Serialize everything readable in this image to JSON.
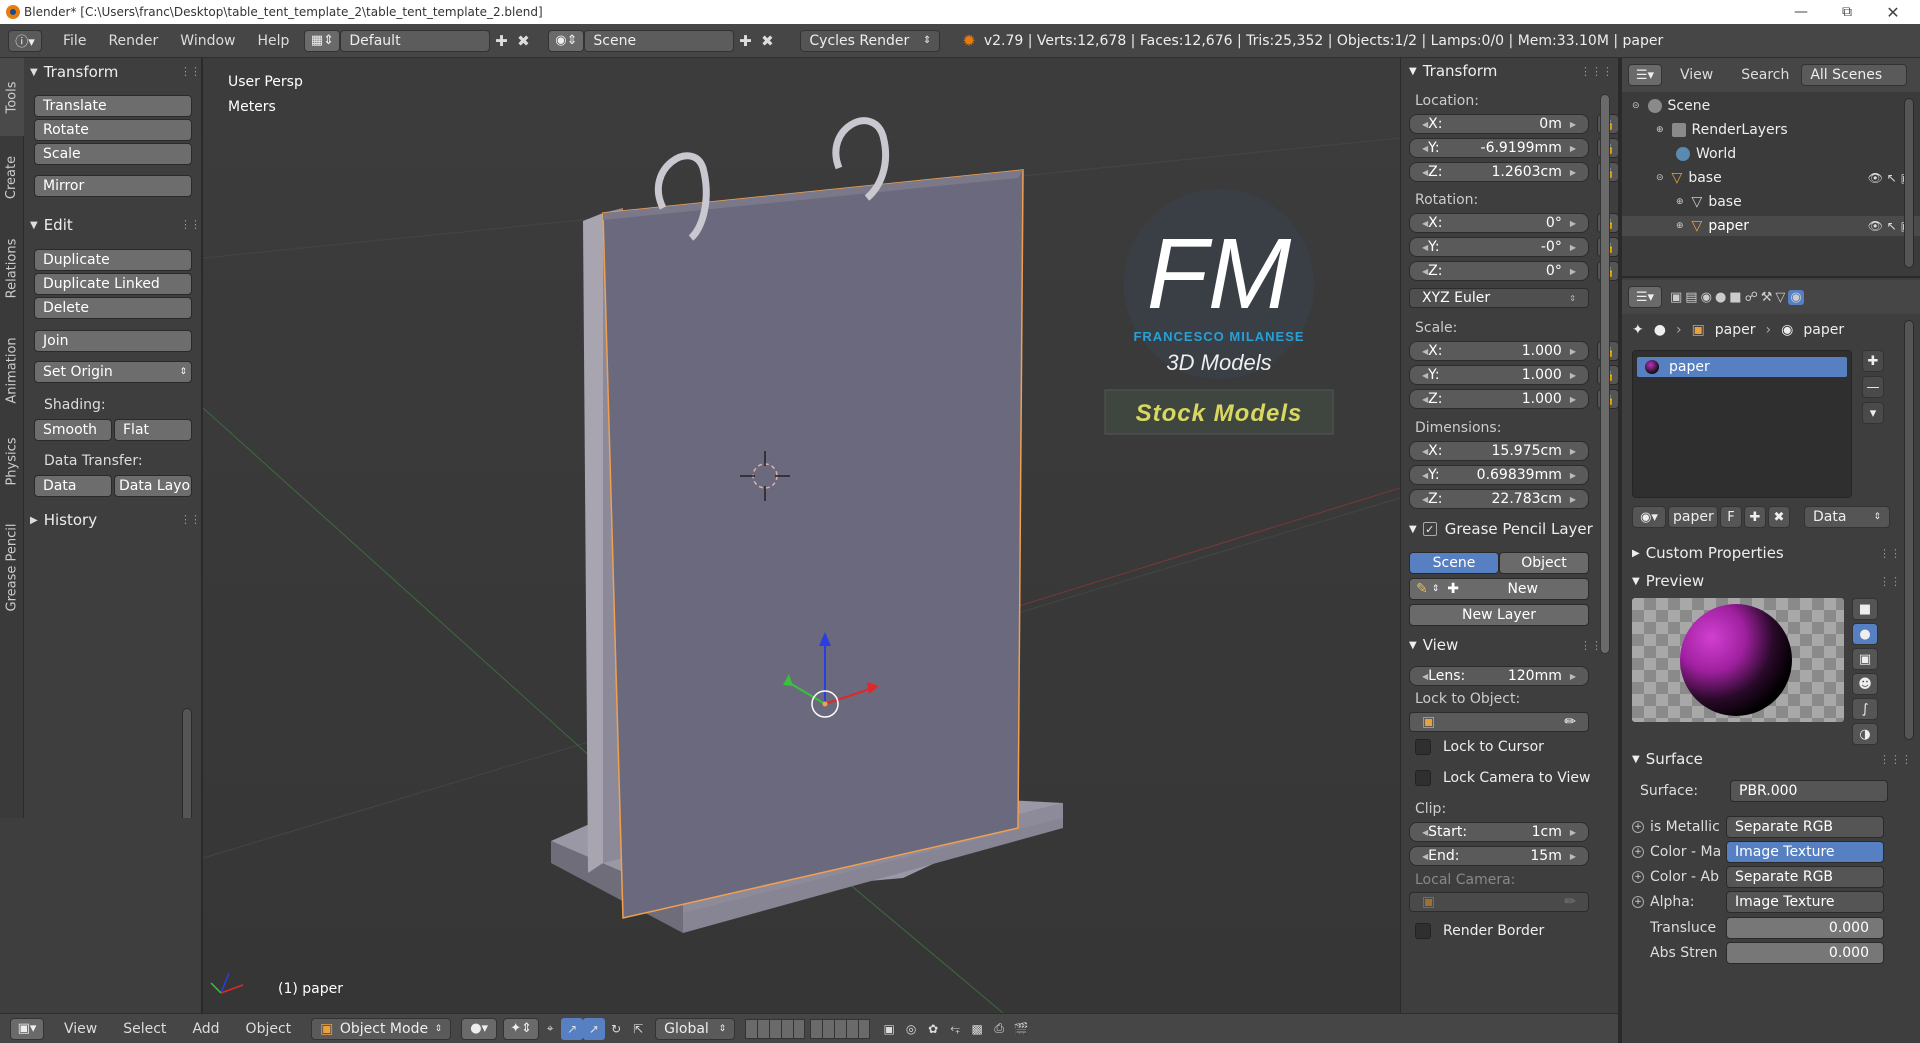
{
  "window": {
    "title": "Blender* [C:\\Users\\franc\\Desktop\\table_tent_template_2\\table_tent_template_2.blend]"
  },
  "topbar": {
    "menus": [
      "File",
      "Render",
      "Window",
      "Help"
    ],
    "layout": "Default",
    "scene": "Scene",
    "engine": "Cycles Render",
    "stats": "v2.79 | Verts:12,678 | Faces:12,676 | Tris:25,352 | Objects:1/2 | Lamps:0/0 | Mem:33.10M | paper"
  },
  "tool_tabs": [
    "Tools",
    "Create",
    "Relations",
    "Animation",
    "Physics",
    "Grease Pencil"
  ],
  "toolbar": {
    "transform_title": "Transform",
    "transform_buttons": [
      "Translate",
      "Rotate",
      "Scale"
    ],
    "mirror": "Mirror",
    "edit_title": "Edit",
    "edit_buttons": [
      "Duplicate",
      "Duplicate Linked",
      "Delete"
    ],
    "join": "Join",
    "set_origin": "Set Origin",
    "shading_label": "Shading:",
    "smooth": "Smooth",
    "flat": "Flat",
    "data_transfer_label": "Data Transfer:",
    "data": "Data",
    "data_layo": "Data Layo",
    "history": "History"
  },
  "viewport": {
    "view_name": "User Persp",
    "units": "Meters",
    "object_label": "(1) paper",
    "logo_letters": "FM",
    "logo_name": "FRANCESCO MILANESE",
    "logo_sub": "3D Models",
    "stock": "Stock Models"
  },
  "npanel": {
    "transform_title": "Transform",
    "location_label": "Location:",
    "location": [
      {
        "axis": "X:",
        "value": "0m"
      },
      {
        "axis": "Y:",
        "value": "-6.9199mm"
      },
      {
        "axis": "Z:",
        "value": "1.2603cm"
      }
    ],
    "rotation_label": "Rotation:",
    "rotation": [
      {
        "axis": "X:",
        "value": "0°"
      },
      {
        "axis": "Y:",
        "value": "-0°"
      },
      {
        "axis": "Z:",
        "value": "0°"
      }
    ],
    "rotation_mode": "XYZ Euler",
    "scale_label": "Scale:",
    "scale": [
      {
        "axis": "X:",
        "value": "1.000"
      },
      {
        "axis": "Y:",
        "value": "1.000"
      },
      {
        "axis": "Z:",
        "value": "1.000"
      }
    ],
    "dimensions_label": "Dimensions:",
    "dimensions": [
      {
        "axis": "X:",
        "value": "15.975cm"
      },
      {
        "axis": "Y:",
        "value": "0.69839mm"
      },
      {
        "axis": "Z:",
        "value": "22.783cm"
      }
    ],
    "gp_title": "Grease Pencil Layer",
    "gp_scene": "Scene",
    "gp_object": "Object",
    "gp_new": "New",
    "gp_new_layer": "New Layer",
    "view_title": "View",
    "lens_label": "Lens:",
    "lens_value": "120mm",
    "lock_object_label": "Lock to Object:",
    "lock_cursor": "Lock to Cursor",
    "lock_camera": "Lock Camera to View",
    "clip_label": "Clip:",
    "clip_start_label": "Start:",
    "clip_start": "1cm",
    "clip_end_label": "End:",
    "clip_end": "15m",
    "local_camera": "Local Camera:",
    "render_border": "Render Border"
  },
  "outliner": {
    "view": "View",
    "search": "Search",
    "filter": "All Scenes",
    "items": [
      "Scene",
      "RenderLayers",
      "World",
      "base",
      "base",
      "paper"
    ]
  },
  "properties": {
    "breadcrumb": [
      "paper",
      "paper"
    ],
    "slot": "paper",
    "material_name": "paper",
    "mat_f": "F",
    "data_select": "Data",
    "custom_props": "Custom Properties",
    "preview": "Preview",
    "surface_title": "Surface",
    "surface_label": "Surface:",
    "surface_value": "PBR.000",
    "inputs": [
      {
        "label": "is Metallic",
        "value": "Separate RGB"
      },
      {
        "label": "Color - Ma",
        "value": "Image Texture"
      },
      {
        "label": "Color - Ab",
        "value": "Separate RGB"
      },
      {
        "label": "Alpha:",
        "value": "Image Texture"
      }
    ],
    "translucent_label": "Transluce",
    "translucent_value": "0.000",
    "abs_label": "Abs Stren",
    "abs_value": "0.000"
  },
  "bottombar": {
    "menus": [
      "View",
      "Select",
      "Add",
      "Object"
    ],
    "mode": "Object Mode",
    "orientation": "Global"
  },
  "colors": {
    "accent": "#5680c2",
    "selection_orange": "#f0a050",
    "logo_blue": "#2a9fd6",
    "stock_yellow": "#d8d860"
  }
}
